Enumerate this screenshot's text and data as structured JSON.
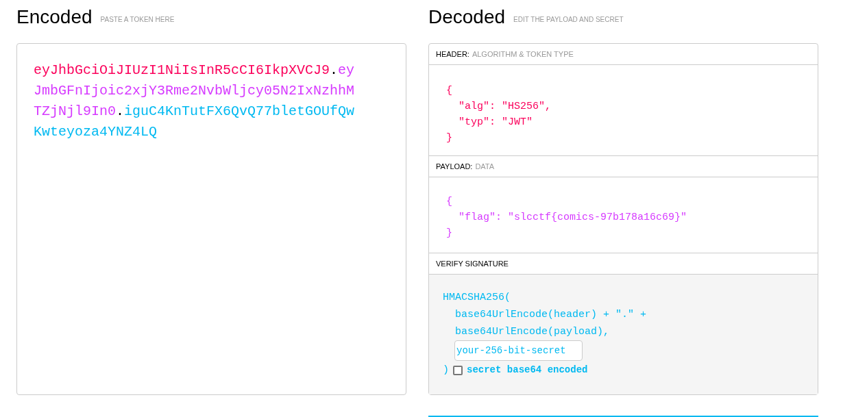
{
  "encoded": {
    "title": "Encoded",
    "hint": "PASTE A TOKEN HERE",
    "token": [
      {
        "text": "eyJhbGciOiJIUzI1NiIsInR5cCI6IkpXVCJ9",
        "color": "#fb015b"
      },
      {
        "text": ".",
        "color": "#000000"
      },
      {
        "text": "eyJmbGFnIjoic2xjY3Rme2NvbWljcy05N2IxNzhhMTZjNjl9In0",
        "color": "#d63aff"
      },
      {
        "text": ".",
        "color": "#000000"
      },
      {
        "text": "iguC4KnTutFX6QvQ77bletGOUfQwKwteyoza4YNZ4LQ",
        "color": "#00b9f1"
      }
    ]
  },
  "decoded": {
    "title": "Decoded",
    "hint": "EDIT THE PAYLOAD AND SECRET",
    "header": {
      "label": "HEADER:",
      "hint": "ALGORITHM & TOKEN TYPE",
      "color": "#fb015b",
      "lines": [
        "{",
        "  \"alg\": \"HS256\",",
        "  \"typ\": \"JWT\"",
        "}"
      ]
    },
    "payload": {
      "label": "PAYLOAD:",
      "hint": "DATA",
      "color": "#d63aff",
      "lines": [
        "{",
        "  \"flag\": \"slcctf{comics-97b178a16c69}\"",
        "}"
      ]
    },
    "signature": {
      "label": "VERIFY SIGNATURE",
      "lines": [
        "HMACSHA256(",
        "  base64UrlEncode(header) + \".\" +",
        "  base64UrlEncode(payload),"
      ],
      "secret_placeholder": "your-256-bit-secret",
      "close": ")",
      "base64": {
        "label": "secret base64 encoded",
        "checked": false
      }
    }
  }
}
